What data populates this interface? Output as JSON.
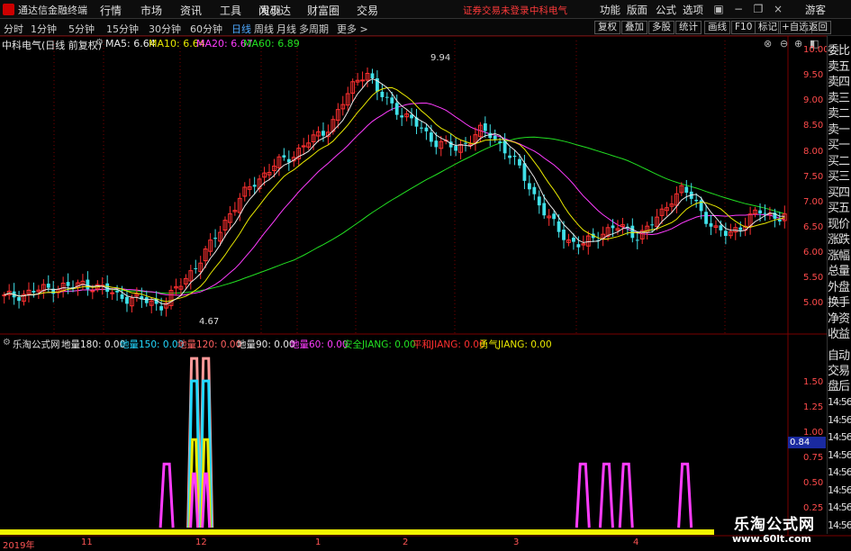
{
  "titlebar": {
    "app_title": "通达信金融终端",
    "menu": [
      "行情",
      "市场",
      "资讯",
      "工具",
      "发现",
      "问小达",
      "财富圈",
      "交易"
    ],
    "login_status": "证券交易未登录",
    "stock": "中科电气",
    "right_menu": [
      "功能",
      "版面",
      "公式",
      "选项"
    ],
    "guest": "游客"
  },
  "toolbar": {
    "periods": [
      "分时",
      "1分钟",
      "5分钟",
      "15分钟",
      "30分钟",
      "60分钟",
      "日线",
      "周线",
      "月线",
      "多周期",
      "更多 >"
    ],
    "active_period": "日线",
    "buttons": [
      "复权",
      "叠加",
      "多股",
      "统计",
      "画线",
      "F10",
      "标记",
      "+自选",
      "返回"
    ]
  },
  "header": {
    "ticker": "中科电气(日线 前复权)",
    "ma": [
      {
        "label": "MA5: 6.64",
        "color": "#e8e8e8"
      },
      {
        "label": "MA10: 6.64",
        "color": "#e8e800"
      },
      {
        "label": "MA20: 6.67",
        "color": "#ff3cff"
      },
      {
        "label": "MA60: 6.89",
        "color": "#22e022"
      }
    ]
  },
  "annotations": {
    "high": "9.94",
    "low": "4.67"
  },
  "price_scale": [
    "10.00",
    "9.50",
    "9.00",
    "8.50",
    "8.00",
    "7.50",
    "7.00",
    "6.50",
    "6.00",
    "5.50",
    "5.00"
  ],
  "indicator": {
    "name": "乐淘公式网",
    "items": [
      {
        "label": "地量180: 0.00",
        "color": "#e8e8e8"
      },
      {
        "label": "地量150: 0.00",
        "color": "#22d8ff"
      },
      {
        "label": "地量120: 0.00",
        "color": "#ff6060"
      },
      {
        "label": "地量90: 0.00",
        "color": "#e8e8e8"
      },
      {
        "label": "地量60: 0.00",
        "color": "#ff3cff"
      },
      {
        "label": "安全JIANG: 0.00",
        "color": "#22e022"
      },
      {
        "label": "平和JIANG: 0.00",
        "color": "#ff3030"
      },
      {
        "label": "勇气JIANG: 0.00",
        "color": "#e8e800"
      }
    ],
    "scale": [
      "1.50",
      "1.25",
      "1.00",
      "0.75",
      "0.50",
      "0.25"
    ],
    "current": "0.84"
  },
  "sidebar": {
    "top": [
      "委比",
      "卖五",
      "卖四",
      "卖三",
      "卖二",
      "卖一",
      "买一",
      "买二",
      "买三",
      "买四",
      "买五",
      "现价",
      "涨跌",
      "涨幅",
      "总量",
      "外盘",
      "换手",
      "净资",
      "收益"
    ],
    "bottom": [
      "自动",
      "交易",
      "盘后"
    ],
    "times": [
      "14:56",
      "14:56",
      "14:56",
      "14:56",
      "14:56",
      "14:56",
      "14:56",
      "14:56"
    ]
  },
  "xaxis": [
    "2019年",
    "11",
    "12",
    "1",
    "2",
    "3",
    "4"
  ],
  "watermark": {
    "site": "乐淘公式网",
    "url": "www.60lt.com"
  },
  "chart_data": {
    "type": "candlestick",
    "ylim": [
      4.5,
      10.2
    ],
    "high": 9.94,
    "low": 4.67,
    "close_path": [
      4.9,
      4.95,
      5.0,
      5.05,
      5.1,
      5.15,
      5.1,
      5.2,
      5.15,
      5.05,
      4.95,
      4.9,
      4.85,
      4.8,
      4.75,
      5.0,
      5.3,
      5.6,
      5.9,
      6.3,
      6.7,
      7.0,
      7.3,
      7.5,
      7.7,
      7.8,
      8.0,
      8.2,
      8.3,
      8.6,
      9.0,
      9.4,
      9.7,
      9.2,
      9.0,
      8.8,
      8.6,
      8.4,
      8.2,
      8.1,
      8.0,
      8.2,
      8.4,
      8.3,
      8.1,
      7.8,
      7.4,
      7.0,
      6.6,
      6.3,
      6.1,
      6.0,
      6.1,
      6.3,
      6.4,
      6.3,
      6.2,
      6.4,
      6.6,
      7.0,
      7.2,
      6.9,
      6.6,
      6.3,
      6.2,
      6.4,
      6.6,
      6.7,
      6.6,
      6.64
    ],
    "indicator_spikes": [
      {
        "x_frac": 0.21,
        "value": 0.65,
        "series": "地量60"
      },
      {
        "x_frac": 0.245,
        "value": 1.73,
        "series": "地量120"
      },
      {
        "x_frac": 0.26,
        "value": 1.73,
        "series": "地量120"
      },
      {
        "x_frac": 0.74,
        "value": 0.65,
        "series": "地量60"
      },
      {
        "x_frac": 0.77,
        "value": 0.65,
        "series": "地量60"
      },
      {
        "x_frac": 0.795,
        "value": 0.65,
        "series": "地量60"
      },
      {
        "x_frac": 0.87,
        "value": 0.65,
        "series": "地量60"
      }
    ]
  }
}
